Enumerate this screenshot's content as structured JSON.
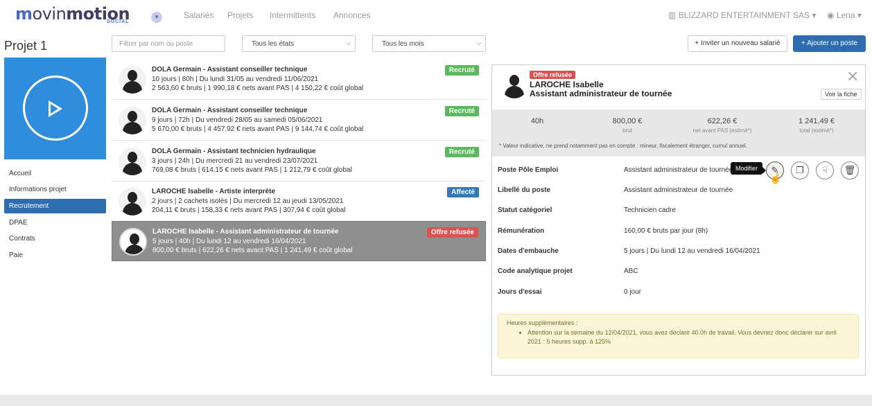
{
  "header": {
    "logo_text": "movinmotion",
    "logo_sub": "SOCIAL",
    "nav": [
      "Salariés",
      "Projets",
      "Intermittents",
      "Annonces"
    ],
    "company": "BLIZZARD ENTERTAINMENT SAS",
    "company_caret": "▾",
    "user": "Lena",
    "user_caret": "▾"
  },
  "page": {
    "title": "Projet 1"
  },
  "filters": {
    "search_placeholder": "Filtrer par nom ou poste",
    "states": "Tous les états",
    "months": "Tous les mois"
  },
  "actions": {
    "invite": "+ Inviter un nouveau salarié",
    "add": "+ Ajouter un poste"
  },
  "sidebar": {
    "items": [
      {
        "label": "Accueil"
      },
      {
        "label": "Informations projet"
      },
      {
        "label": "Recrutement"
      },
      {
        "label": "DPAE"
      },
      {
        "label": "Contrats"
      },
      {
        "label": "Paie"
      }
    ]
  },
  "list": {
    "rows": [
      {
        "name": "DOLA Germain - Assistant conseiller technique",
        "line2": "10 jours | 80h | Du lundi 31/05 au vendredi 11/06/2021",
        "line3": "2 563,60 € bruts | 1 990,18 € nets avant PAS | 4 150,22 € coût global",
        "status": "Recruté",
        "status_color": "#5cb85c"
      },
      {
        "name": "DOLA Germain - Assistant conseiller technique",
        "line2": "9 jours | 72h | Du vendredi 28/05 au samedi 05/06/2021",
        "line3": "5 670,00 € bruts | 4 457,92 € nets avant PAS | 9 144,74 € coût global",
        "status": "Recruté",
        "status_color": "#5cb85c"
      },
      {
        "name": "DOLA Germain - Assistant technicien hydraulique",
        "line2": "3 jours | 24h | Du mercredi 21 au vendredi 23/07/2021",
        "line3": "769,08 € bruts | 614,15 € nets avant PAS | 1 212,79 € coût global",
        "status": "Recruté",
        "status_color": "#5cb85c"
      },
      {
        "name": "LAROCHE Isabelle - Artiste interprète",
        "line2": "2 jours | 2 cachets isolés | Du mercredi 12 au jeudi 13/05/2021",
        "line3": "204,11 € bruts | 158,33 € nets avant PAS | 307,94 € coût global",
        "status": "Affecté",
        "status_color": "#337ab7"
      },
      {
        "name": "LAROCHE Isabelle - Assistant administrateur de tournée",
        "line2": "5 jours | 40h | Du lundi 12 au vendredi 16/04/2021",
        "line3": "800,00 € bruts | 622,26 € nets avant PAS | 1 241,49 € coût global",
        "status": "Offre refusée",
        "status_color": "#d9534f"
      }
    ]
  },
  "detail": {
    "badge": "Offre refusée",
    "name": "LAROCHE Isabelle",
    "role": "Assistant administrateur de tournée",
    "voir_fiche": "Voir la fiche",
    "close": "✕",
    "stats": [
      {
        "value": "40h",
        "sub": ""
      },
      {
        "value": "800,00 €",
        "sub": "brut"
      },
      {
        "value": "622,26 €",
        "sub": "net avant PAS (estimé*)"
      },
      {
        "value": "1 241,49 €",
        "sub": "total (estimé*)"
      }
    ],
    "note": "* Valeur indicative, ne prend notamment pas en compte : mineur, fiscalement étranger, cumul annuel.",
    "fields": [
      {
        "label": "Poste Pôle Emploi",
        "value": "Assistant administrateur de tournée"
      },
      {
        "label": "Libellé du poste",
        "value": "Assistant administrateur de tournée"
      },
      {
        "label": "Statut catégoriel",
        "value": "Technicien cadre"
      },
      {
        "label": "Rémunération",
        "value": "160,00 € bruts par jour (8h)"
      },
      {
        "label": "Dates d'embauche",
        "value": "5 jours | Du lundi 12 au vendredi 16/04/2021"
      },
      {
        "label": "Code analytique projet",
        "value": "ABC"
      },
      {
        "label": "Jours d'essai",
        "value": "0 jour"
      }
    ],
    "tooltip": "Modifier",
    "icons": [
      {
        "name": "pencil-icon",
        "glyph": "✎"
      },
      {
        "name": "copy-icon",
        "glyph": "❐"
      },
      {
        "name": "thumbs-down-icon",
        "glyph": "☟"
      },
      {
        "name": "trash-icon",
        "glyph": "🗑"
      }
    ],
    "warning": {
      "title": "Heures supplémentaires :",
      "text": "Attention sur la semaine du 12/04/2021, vous avez déclaré 40.0h de travail. Vous devriez donc déclarer sur avril 2021 : 5 heures supp. à 125%"
    }
  }
}
